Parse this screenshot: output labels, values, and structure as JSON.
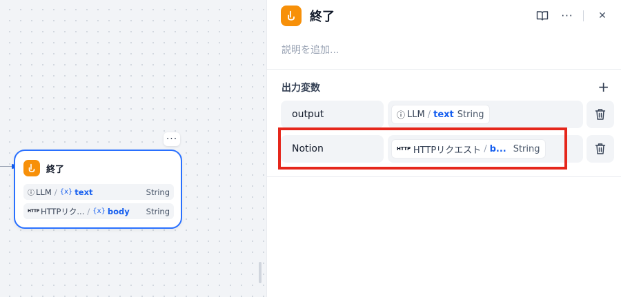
{
  "node": {
    "title": "終了",
    "menu": "···",
    "vars": [
      {
        "source_icon": "ⓘ",
        "source": "LLM",
        "separator": "/",
        "var_icon": "{x}",
        "var": "text",
        "type": "String"
      },
      {
        "source_icon": "HTTP",
        "source": "HTTPリク...",
        "separator": "/",
        "var_icon": "{x}",
        "var": "body",
        "type": "String"
      }
    ]
  },
  "panel": {
    "title": "終了",
    "description_placeholder": "説明を追加...",
    "more_label": "···",
    "close_label": "✕",
    "section_title": "出力変数",
    "add_label": "+",
    "outputs": [
      {
        "name": "output",
        "source_icon": "ⓘ",
        "source": "LLM",
        "separator": "/",
        "var": "text",
        "type": "String"
      },
      {
        "name": "Notion",
        "source_icon": "HTTP",
        "source": "HTTPリクエスト",
        "separator": "/",
        "var": "b...",
        "type": "String"
      }
    ]
  },
  "colors": {
    "accent": "#155eef",
    "node_icon": "#f79009",
    "highlight": "#e5261b"
  }
}
